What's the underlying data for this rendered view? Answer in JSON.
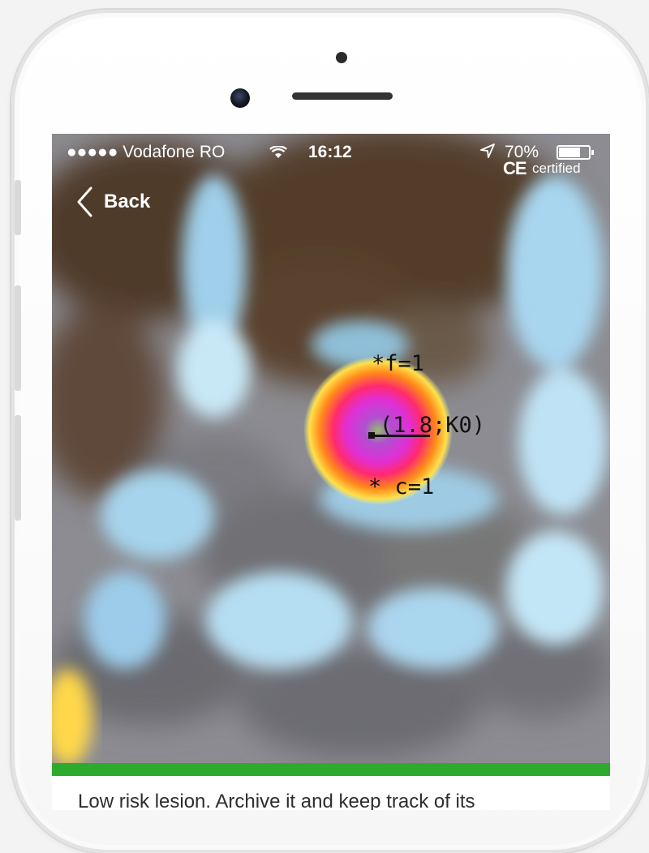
{
  "status_bar": {
    "carrier": "●●●●● Vodafone RO",
    "time": "16:12",
    "battery": "70%"
  },
  "certification": {
    "mark": "CE",
    "label": "certified"
  },
  "nav": {
    "back_label": "Back"
  },
  "heatmap": {
    "annotations": {
      "top": "*f=1",
      "center": "(1.8;K0)",
      "bottom": "* c=1"
    }
  },
  "result": {
    "risk_color": "#2eab2e",
    "message": "Low risk lesion. Archive it and keep track of its"
  },
  "colors": {
    "hot_core": "#cc33cc",
    "hot_ring": "#ff8c1a",
    "cool": "#a9d8f0",
    "background_dark": "#4d3a2a"
  }
}
